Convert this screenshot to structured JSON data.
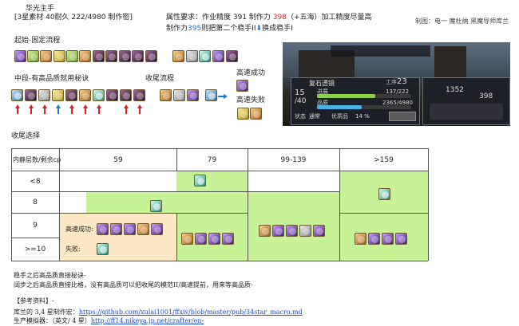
{
  "header": {
    "title": "华光主手",
    "subtitle": "[3星素材 40耐久 222/4980 制作密]",
    "attr_line1_a": "属性要求：作业精度 391 制作力 ",
    "attr_line1_red": "398",
    "attr_line1_b": "（+五海）加工精度尽量高",
    "attr_line2_a": "制作力",
    "attr_line2_blue": "395",
    "attr_line2_b": "则把第二个稳手II",
    "attr_line2_c": "换成稳手I",
    "credit": "制图：电一 魔杜纳 黑魔导师库兰"
  },
  "sections": {
    "opening": "起始-固定流程",
    "midgame": "中段-有高品质就用秘诀",
    "finish": "收尾流程",
    "legend_success": "高速成功",
    "legend_fail": "高速失败"
  },
  "game": {
    "item_name": "复石透镜",
    "durability": "15",
    "durability_max": "40",
    "progress_label": "进展",
    "quality_label": "品质",
    "progress_value": "137/222",
    "quality_value": "2365/4980",
    "status_label": "状态",
    "status_value": "通常",
    "hq_label": "优质品",
    "hq_value": "14",
    "step_label": "工序",
    "step_value": "23",
    "cp_value": "1352",
    "cp_max": "398"
  },
  "table": {
    "section_title": "收尾选择",
    "corner": "内静层数/剩余cp",
    "col_headers": [
      "59",
      "79",
      "99-139",
      ">159"
    ],
    "row_headers": [
      "<8",
      "8",
      "9",
      ">=10"
    ],
    "success_label": "高速成功:",
    "fail_label": "失败:"
  },
  "notes": {
    "line1": "稳手之后高品质直接秘诀-",
    "line2": "阔步之后高品质直接比格，没有高品质可以把收尾的模范II/高速提前，用来等高品质-",
    "refs_title": "【参考资料】-",
    "ref1_label": "库兰的 3,4 星制作宏：",
    "ref1_url": "https://github.com/xulai1001/ffxiv/blob/master/pub/34star_macro.md",
    "ref2_label": "生产模拟器：（英文/ 4 星）",
    "ref2_url": "http://ff14.nikeya.jp.net/crafter/en-"
  },
  "colors": {
    "highlight_green": "#c8f296",
    "highlight_peach": "#fde8c6",
    "accent_red": "#e02020",
    "accent_blue": "#1a78d8"
  }
}
